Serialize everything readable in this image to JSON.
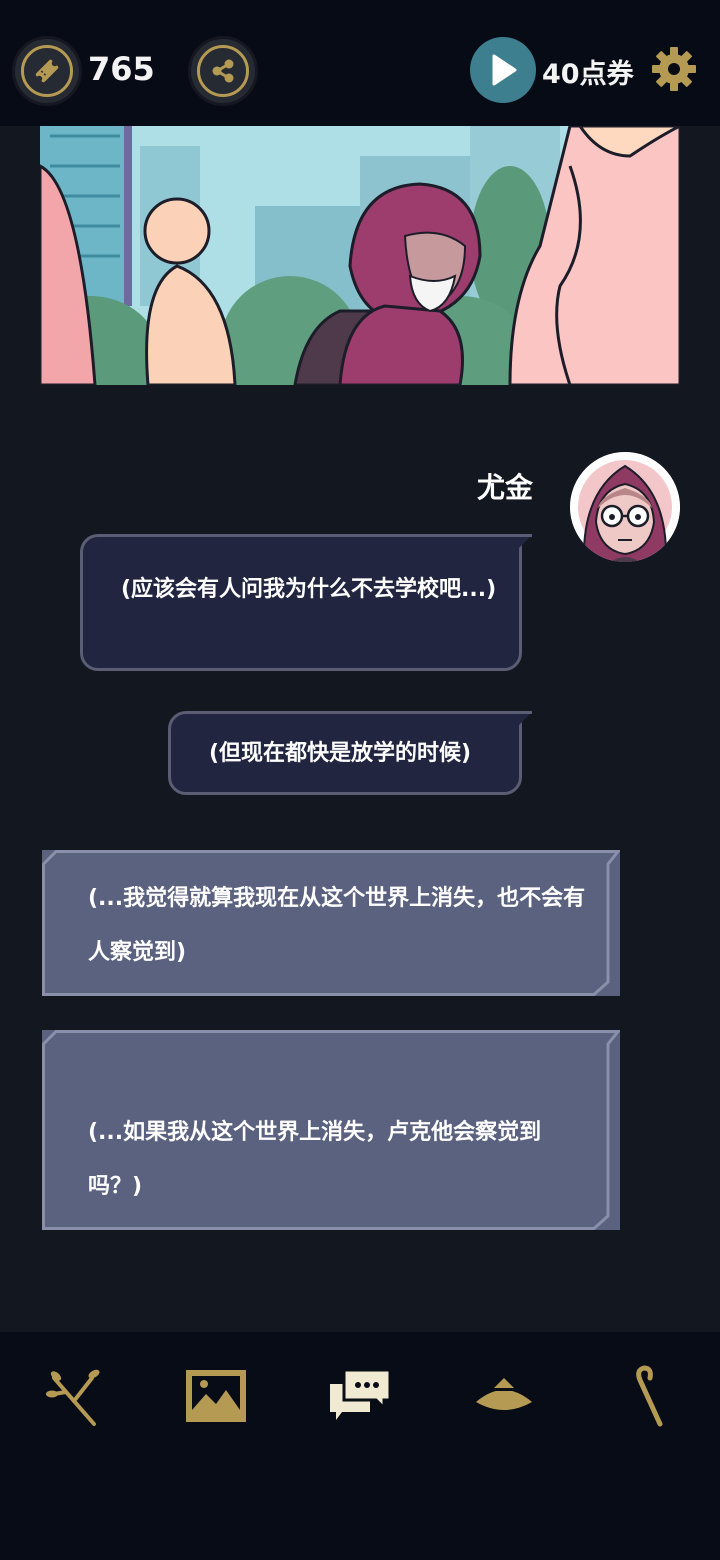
{
  "topbar": {
    "ticket_count": "765",
    "coupon_label": "40点券"
  },
  "dialogue": {
    "speaker": "尤金",
    "messages": [
      "(应该会有人问我为什么不去学校吧...)",
      "(但现在都快是放学的时候)",
      "(...我觉得就算我现在从这个世界上消失，也不会有人察觉到)",
      "(...如果我从这个世界上消失，卢克他会察觉到吗？)"
    ]
  },
  "bottom_nav": {
    "items": [
      "branch-icon",
      "gallery-icon",
      "chat-log-icon",
      "hat-icon",
      "cane-icon"
    ],
    "active_index": 2
  },
  "colors": {
    "accent_gold": "#b59a54",
    "play_teal": "#3d7f8e",
    "bubble_dark": "#212540",
    "bubble_light": "#5b627f"
  }
}
